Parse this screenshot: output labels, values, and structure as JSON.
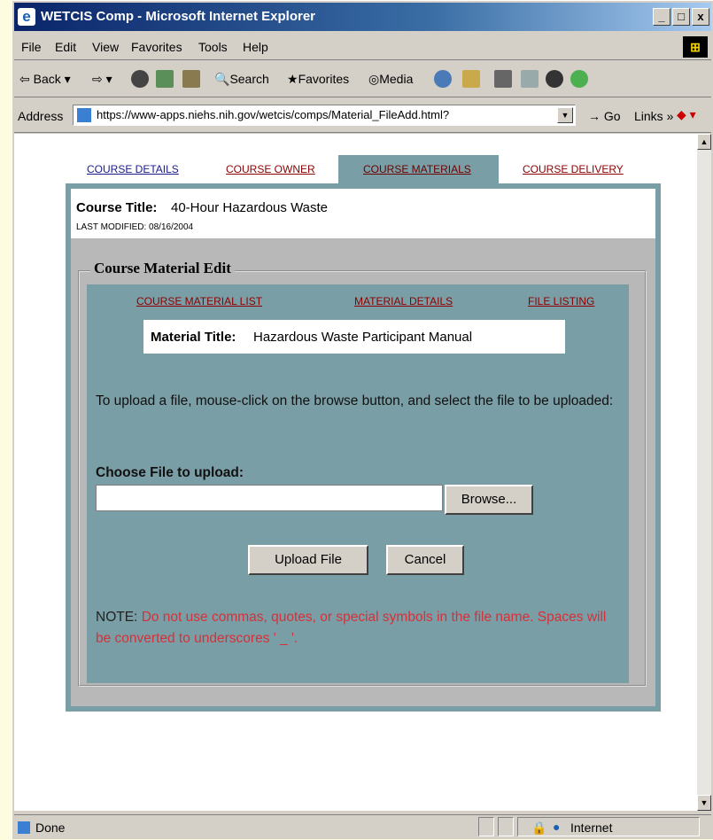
{
  "window": {
    "title": "WETCIS Comp - Microsoft Internet Explorer",
    "controls": [
      "_",
      "□",
      "x"
    ]
  },
  "menubar": {
    "items": [
      "File",
      "Edit",
      "View",
      "Favorites",
      "Tools",
      "Help"
    ]
  },
  "toolbar": {
    "back": "Back",
    "search": "Search",
    "favorites": "Favorites",
    "media": "Media"
  },
  "address": {
    "label": "Address",
    "url": "https://www-apps.niehs.nih.gov/wetcis/comps/Material_FileAdd.html?",
    "go": "Go",
    "links": "Links"
  },
  "tabs": {
    "details": "COURSE DETAILS",
    "owner": "COURSE OWNER",
    "materials": "COURSE MATERIALS",
    "delivery": "COURSE DELIVERY"
  },
  "course": {
    "title_label": "Course Title:",
    "title_value": "40-Hour Hazardous Waste",
    "last_modified": "LAST MODIFIED: 08/16/2004"
  },
  "edit": {
    "legend": "Course Material Edit",
    "links": {
      "list": "COURSE MATERIAL LIST",
      "details": "MATERIAL DETAILS",
      "files": "FILE LISTING"
    },
    "material_title_label": "Material Title:",
    "material_title_value": "Hazardous Waste Participant Manual",
    "instructions": "To upload a file, mouse-click on the browse button, and select the file to be uploaded:",
    "choose_label": "Choose File to upload:",
    "file_value": "",
    "browse_label": "Browse...",
    "upload_label": "Upload File",
    "cancel_label": "Cancel",
    "note_label": "NOTE:",
    "note_text": "Do not use commas, quotes, or special symbols in the file name. Spaces will be converted to underscores ' _ '."
  },
  "status": {
    "text": "Done",
    "zone": "Internet"
  },
  "colors": {
    "panel": "#7a9ea5",
    "grey": "#b8b8b8",
    "link": "#8b0000",
    "note": "#d6303a"
  }
}
